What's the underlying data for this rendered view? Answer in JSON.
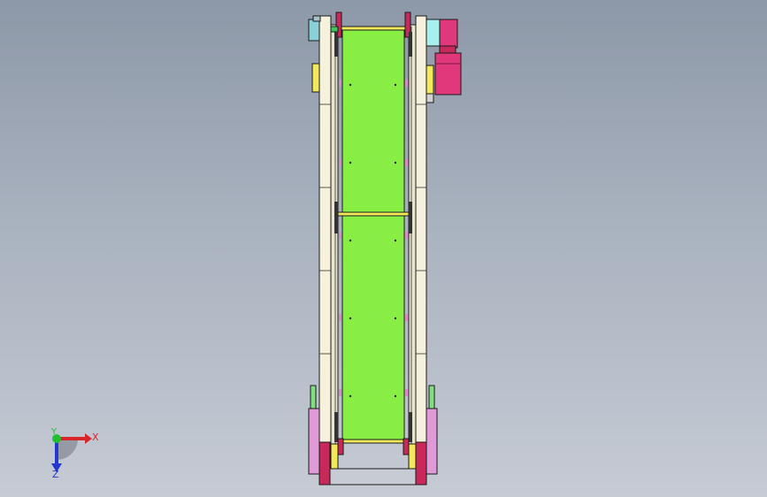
{
  "scene": {
    "background_top": "#8d98a8",
    "background_bottom": "#c6cbd4",
    "object": "belt-conveyor-top-view",
    "colors": {
      "belt": "#88ee44",
      "frame": "#f5f1dc",
      "motor": "#e0387a",
      "gearbox": "#a8f0f0",
      "bracket_pink": "#e09ad8",
      "bracket_red": "#c8285a",
      "bearing_yellow": "#f2e85a",
      "accent_teal": "#8ad0d8",
      "outline": "#1a1a1a"
    }
  },
  "triad": {
    "x_label": "X",
    "y_label": "Y",
    "z_label": "Z",
    "x_color": "#d8262b",
    "y_color": "#20c030",
    "z_color": "#2338d0"
  }
}
